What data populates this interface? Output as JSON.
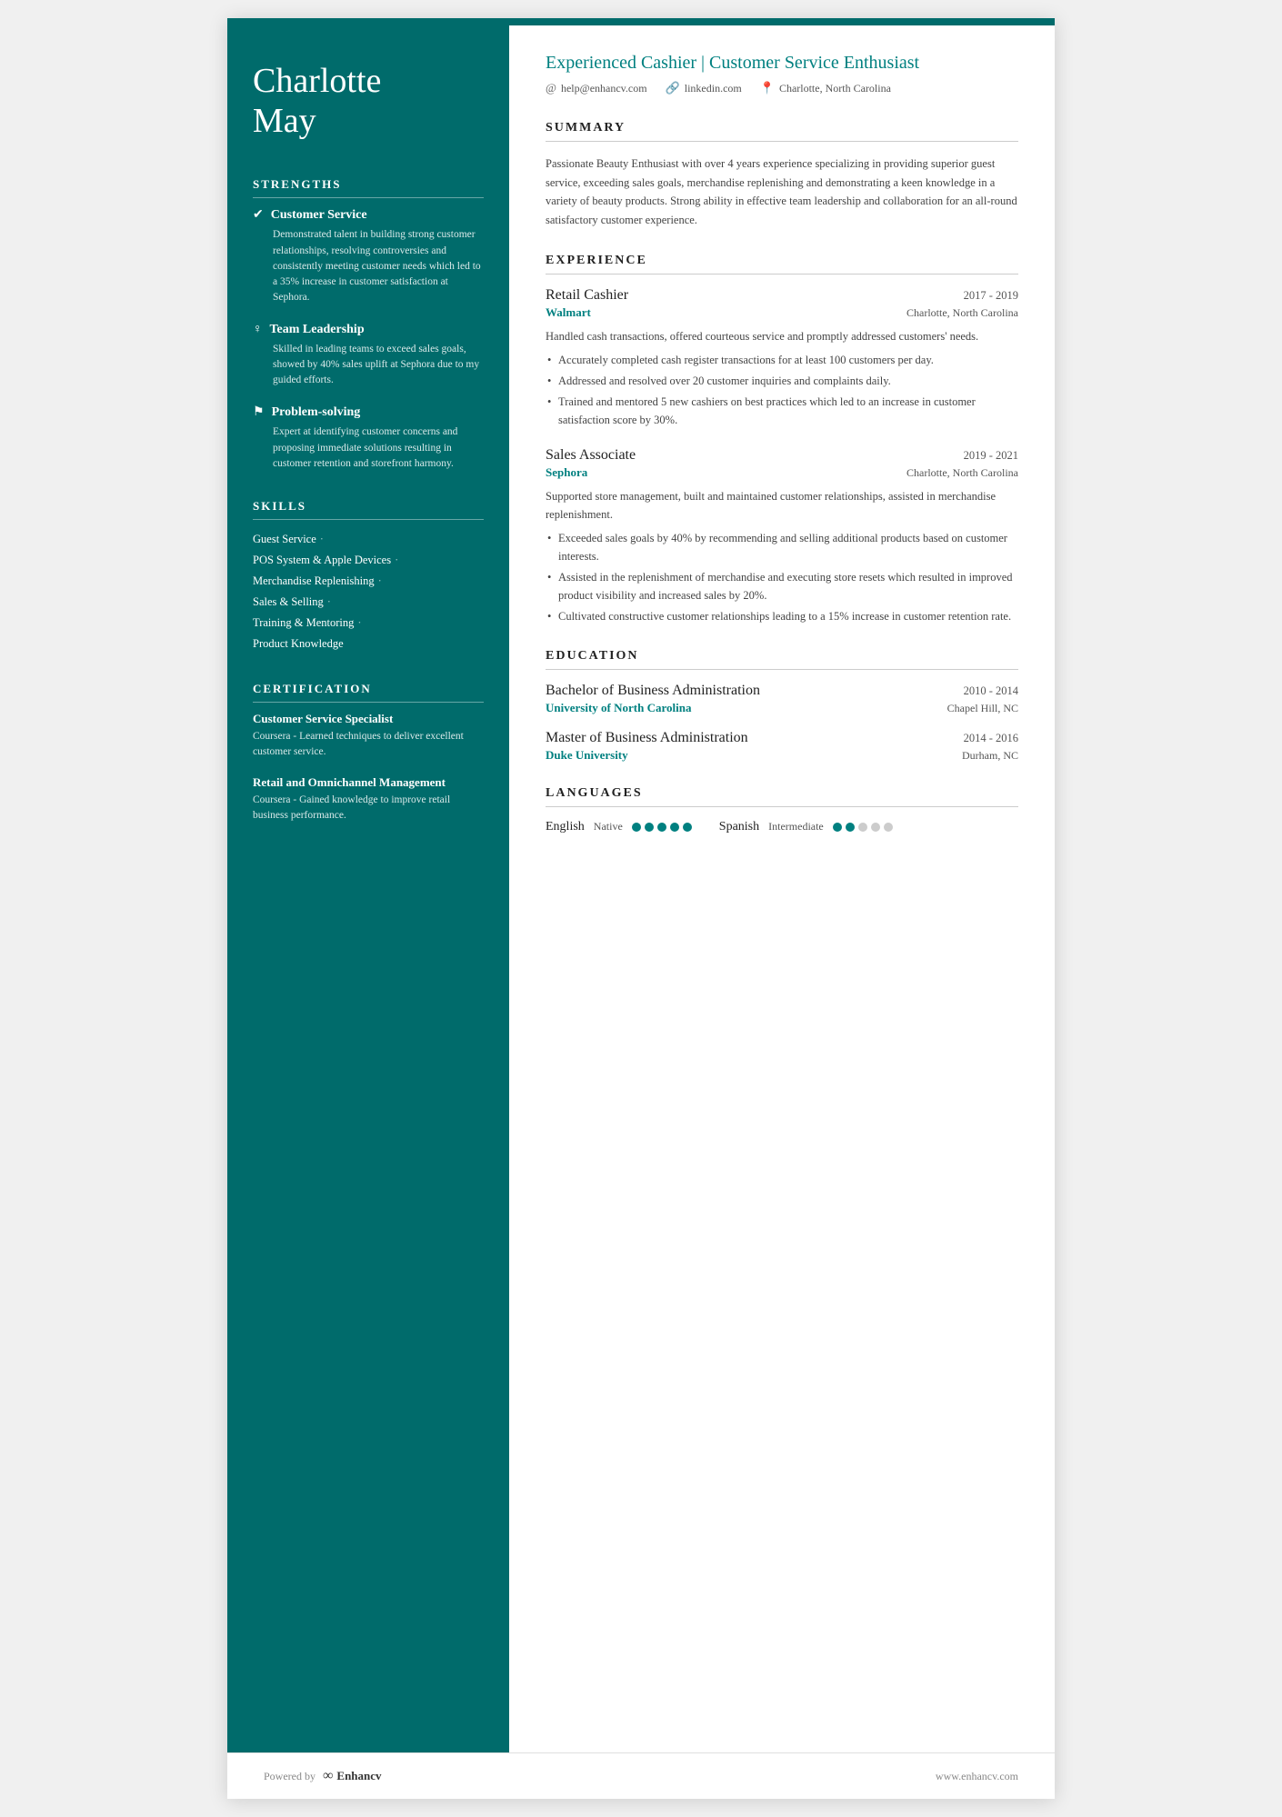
{
  "sidebar": {
    "name_line1": "Charlotte",
    "name_line2": "May",
    "strengths_title": "STRENGTHS",
    "strengths": [
      {
        "icon": "✔",
        "title": "Customer Service",
        "desc": "Demonstrated talent in building strong customer relationships, resolving controversies and consistently meeting customer needs which led to a 35% increase in customer satisfaction at Sephora."
      },
      {
        "icon": "♀",
        "title": "Team Leadership",
        "desc": "Skilled in leading teams to exceed sales goals, showed by 40% sales uplift at Sephora due to my guided efforts."
      },
      {
        "icon": "⚑",
        "title": "Problem-solving",
        "desc": "Expert at identifying customer concerns and proposing immediate solutions resulting in customer retention and storefront harmony."
      }
    ],
    "skills_title": "SKILLS",
    "skills": [
      "Guest Service",
      "POS System & Apple Devices",
      "Merchandise Replenishing",
      "Sales & Selling",
      "Training & Mentoring",
      "Product Knowledge"
    ],
    "cert_title": "CERTIFICATION",
    "certifications": [
      {
        "title": "Customer Service Specialist",
        "desc": "Coursera - Learned techniques to deliver excellent customer service."
      },
      {
        "title": "Retail and Omnichannel Management",
        "desc": "Coursera - Gained knowledge to improve retail business performance."
      }
    ]
  },
  "header": {
    "job_title": "Experienced Cashier | Customer Service Enthusiast",
    "email": "help@enhancv.com",
    "linkedin": "linkedin.com",
    "location": "Charlotte, North Carolina"
  },
  "summary": {
    "title": "SUMMARY",
    "text": "Passionate Beauty Enthusiast with over 4 years experience specializing in providing superior guest service, exceeding sales goals, merchandise replenishing and demonstrating a keen knowledge in a variety of beauty products. Strong ability in effective team leadership and collaboration for an all-round satisfactory customer experience."
  },
  "experience": {
    "title": "EXPERIENCE",
    "items": [
      {
        "role": "Retail Cashier",
        "dates": "2017 - 2019",
        "company": "Walmart",
        "location": "Charlotte, North Carolina",
        "desc": "Handled cash transactions, offered courteous service and promptly addressed customers' needs.",
        "bullets": [
          "Accurately completed cash register transactions for at least 100 customers per day.",
          "Addressed and resolved over 20 customer inquiries and complaints daily.",
          "Trained and mentored 5 new cashiers on best practices which led to an increase in customer satisfaction score by 30%."
        ]
      },
      {
        "role": "Sales Associate",
        "dates": "2019 - 2021",
        "company": "Sephora",
        "location": "Charlotte, North Carolina",
        "desc": "Supported store management, built and maintained customer relationships, assisted in merchandise replenishment.",
        "bullets": [
          "Exceeded sales goals by 40% by recommending and selling additional products based on customer interests.",
          "Assisted in the replenishment of merchandise and executing store resets which resulted in improved product visibility and increased sales by 20%.",
          "Cultivated constructive customer relationships leading to a 15% increase in customer retention rate."
        ]
      }
    ]
  },
  "education": {
    "title": "EDUCATION",
    "items": [
      {
        "degree": "Bachelor of Business Administration",
        "dates": "2010 - 2014",
        "school": "University of North Carolina",
        "location": "Chapel Hill, NC"
      },
      {
        "degree": "Master of Business Administration",
        "dates": "2014 - 2016",
        "school": "Duke University",
        "location": "Durham, NC"
      }
    ]
  },
  "languages": {
    "title": "LANGUAGES",
    "items": [
      {
        "name": "English",
        "level": "Native",
        "dots": 5,
        "filled": 5
      },
      {
        "name": "Spanish",
        "level": "Intermediate",
        "dots": 5,
        "filled": 2
      }
    ]
  },
  "footer": {
    "powered_by": "Powered by",
    "brand": "Enhancv",
    "website": "www.enhancv.com"
  }
}
